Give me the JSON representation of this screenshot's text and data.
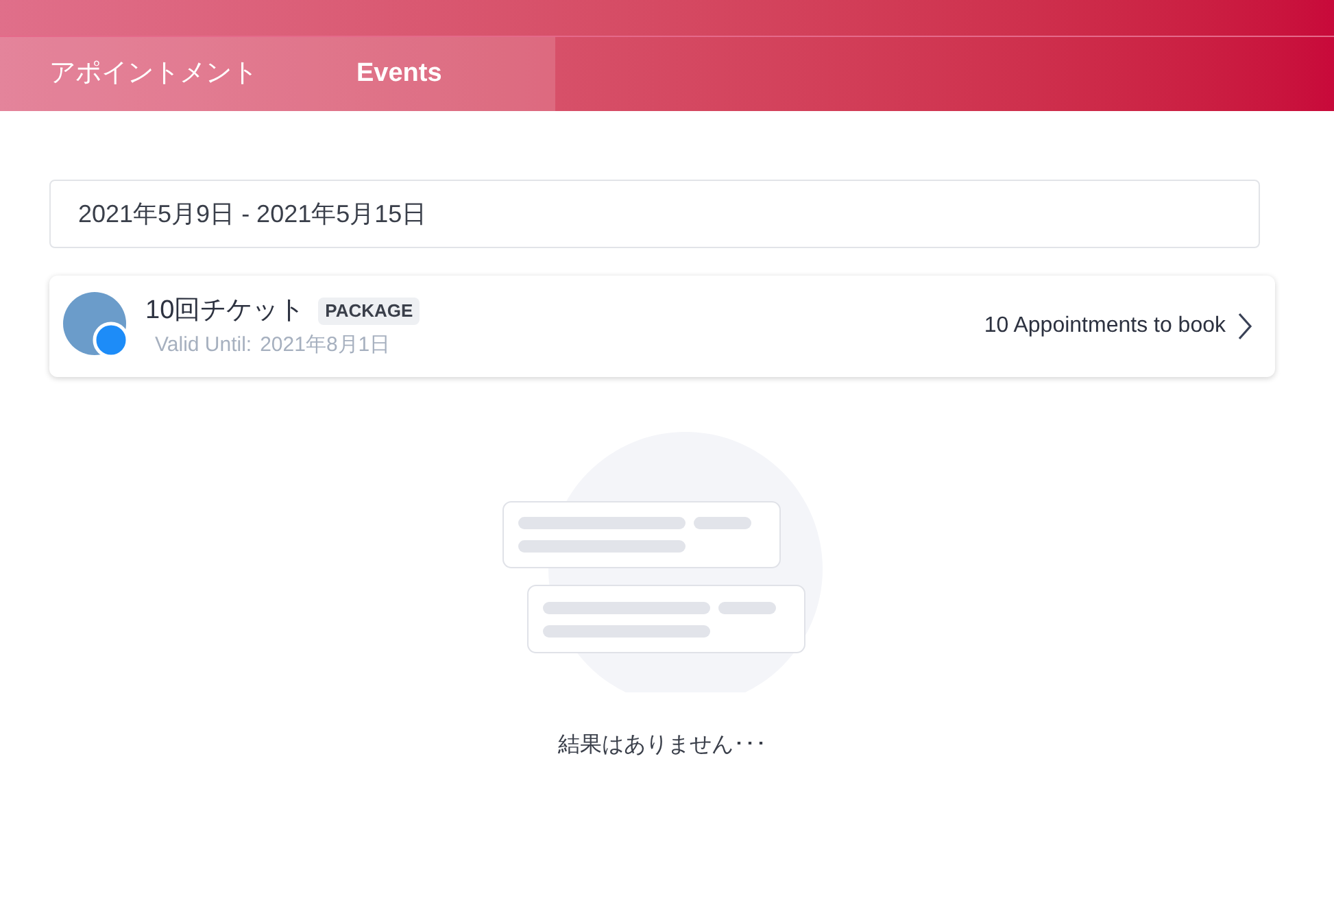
{
  "tabs": [
    {
      "label": "アポイントメント",
      "selected": false
    },
    {
      "label": "Events",
      "selected": true
    }
  ],
  "date_range": {
    "value": "2021年5月9日 - 2021年5月15日"
  },
  "package": {
    "title": "10回チケット",
    "badge": "PACKAGE",
    "valid_label": "Valid Until:",
    "valid_date": "2021年8月1日",
    "action": "10 Appointments to book"
  },
  "empty_state": {
    "message": "結果はありません･･･"
  }
}
